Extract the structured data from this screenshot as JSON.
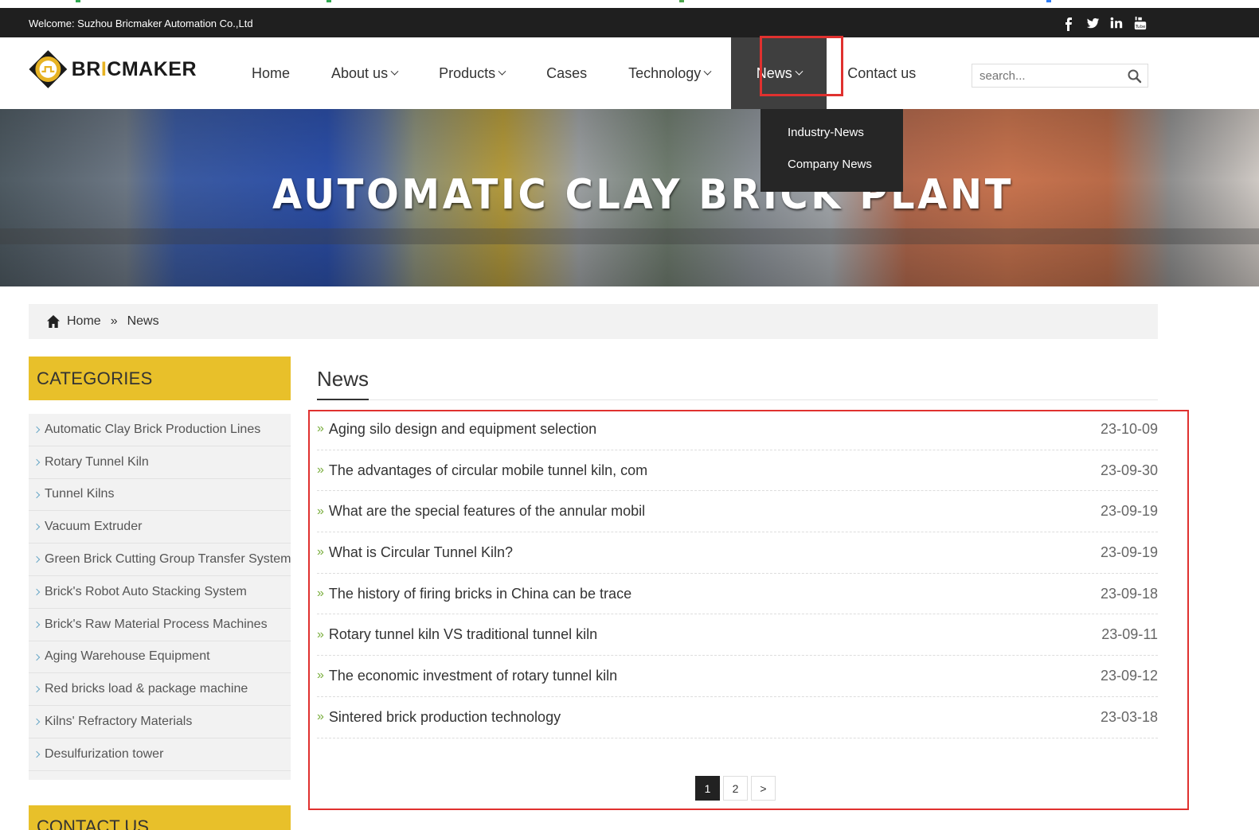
{
  "topbar": {
    "welcome": "Welcome: Suzhou Bricmaker Automation Co.,Ltd",
    "social_icons": [
      "facebook-icon",
      "twitter-icon",
      "linkedin-icon",
      "youtube-icon"
    ]
  },
  "logo": {
    "brand_pre": "BR",
    "brand_i": "I",
    "brand_post": "CMAKER"
  },
  "nav": {
    "home": "Home",
    "about": "About us",
    "products": "Products",
    "cases": "Cases",
    "technology": "Technology",
    "news": "News",
    "contact": "Contact us"
  },
  "search": {
    "placeholder": "search..."
  },
  "news_dropdown": [
    "Industry-News",
    "Company News"
  ],
  "banner": {
    "title": "AUTOMATIC CLAY BRICK PLANT"
  },
  "breadcrumb": {
    "home": "Home",
    "separator": "»",
    "current": "News"
  },
  "sidebar": {
    "categories_title": "CATEGORIES",
    "categories": [
      "Automatic Clay Brick Production Lines",
      "Rotary Tunnel Kiln",
      "Tunnel Kilns",
      "Vacuum Extruder",
      "Green Brick Cutting Group Transfer System",
      "Brick's Robot Auto Stacking System",
      "Brick's Raw Material Process Machines",
      "Aging Warehouse Equipment",
      "Red bricks load & package machine",
      "Kilns' Refractory Materials",
      "Desulfurization tower"
    ],
    "contact_title": "CONTACT US"
  },
  "main": {
    "title": "News",
    "bullet": "»",
    "items": [
      {
        "title": "Aging silo design and equipment selection",
        "date": "23-10-09"
      },
      {
        "title": "The advantages of circular mobile tunnel kiln, com",
        "date": "23-09-30"
      },
      {
        "title": "What are the special features of the annular mobil",
        "date": "23-09-19"
      },
      {
        "title": "What is Circular Tunnel Kiln?",
        "date": "23-09-19"
      },
      {
        "title": "The history of firing bricks in China can be trace",
        "date": "23-09-18"
      },
      {
        "title": "Rotary tunnel kiln VS traditional tunnel kiln",
        "date": "23-09-11"
      },
      {
        "title": "The economic investment of rotary tunnel kiln",
        "date": "23-09-12"
      },
      {
        "title": "Sintered brick production technology",
        "date": "23-03-18"
      }
    ]
  },
  "pagination": {
    "pages": [
      "1",
      "2"
    ],
    "current": "1",
    "next": ">"
  },
  "colors": {
    "accent_yellow": "#e8c02a",
    "highlight_red": "#e0312f",
    "dark_bar": "#1f1f1f",
    "bullet_green": "#7aae3e"
  }
}
